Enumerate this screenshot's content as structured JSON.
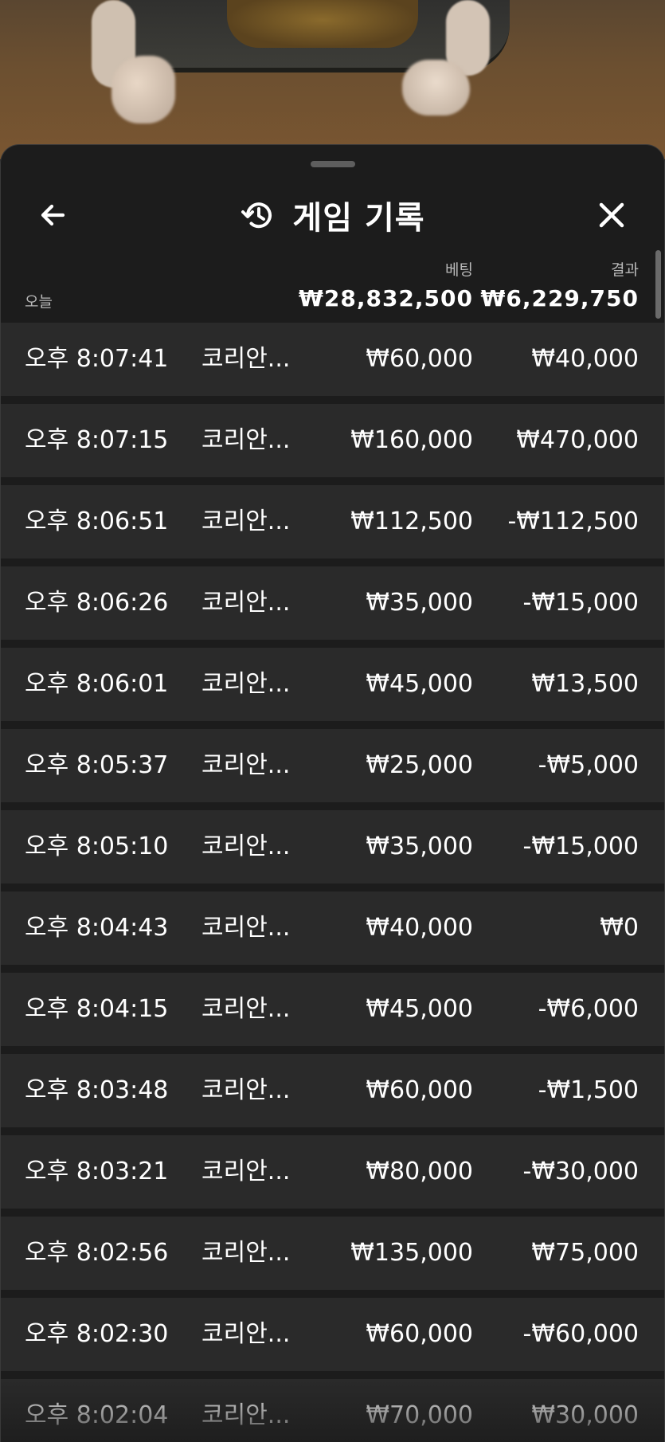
{
  "header": {
    "title": "게임 기록",
    "back_icon": "arrow-left-icon",
    "history_icon": "history-icon",
    "close_icon": "close-icon"
  },
  "summary": {
    "date_label": "오늘",
    "bet_header": "베팅",
    "result_header": "결과",
    "bet_total": "₩28,832,500",
    "result_total": "₩6,229,750"
  },
  "rows": [
    {
      "time": "오후 8:07:41",
      "game": "코리안...",
      "bet": "₩60,000",
      "result": "₩40,000"
    },
    {
      "time": "오후 8:07:15",
      "game": "코리안...",
      "bet": "₩160,000",
      "result": "₩470,000"
    },
    {
      "time": "오후 8:06:51",
      "game": "코리안...",
      "bet": "₩112,500",
      "result": "-₩112,500"
    },
    {
      "time": "오후 8:06:26",
      "game": "코리안...",
      "bet": "₩35,000",
      "result": "-₩15,000"
    },
    {
      "time": "오후 8:06:01",
      "game": "코리안...",
      "bet": "₩45,000",
      "result": "₩13,500"
    },
    {
      "time": "오후 8:05:37",
      "game": "코리안...",
      "bet": "₩25,000",
      "result": "-₩5,000"
    },
    {
      "time": "오후 8:05:10",
      "game": "코리안...",
      "bet": "₩35,000",
      "result": "-₩15,000"
    },
    {
      "time": "오후 8:04:43",
      "game": "코리안...",
      "bet": "₩40,000",
      "result": "₩0"
    },
    {
      "time": "오후 8:04:15",
      "game": "코리안...",
      "bet": "₩45,000",
      "result": "-₩6,000"
    },
    {
      "time": "오후 8:03:48",
      "game": "코리안...",
      "bet": "₩60,000",
      "result": "-₩1,500"
    },
    {
      "time": "오후 8:03:21",
      "game": "코리안...",
      "bet": "₩80,000",
      "result": "-₩30,000"
    },
    {
      "time": "오후 8:02:56",
      "game": "코리안...",
      "bet": "₩135,000",
      "result": "₩75,000"
    },
    {
      "time": "오후 8:02:30",
      "game": "코리안...",
      "bet": "₩60,000",
      "result": "-₩60,000"
    },
    {
      "time": "오후 8:02:04",
      "game": "코리안...",
      "bet": "₩70,000",
      "result": "₩30,000"
    }
  ]
}
